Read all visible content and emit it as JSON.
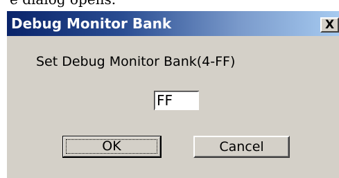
{
  "background": {
    "partial_text": "e dialog opens."
  },
  "dialog": {
    "title": "Debug Monitor Bank",
    "close_icon": "close-icon",
    "close_glyph": "X",
    "prompt": "Set Debug Monitor Bank(4-FF)",
    "input_value": "FF",
    "ok_label": "OK",
    "cancel_label": "Cancel"
  },
  "colors": {
    "title_bar_start": "#0a246a",
    "title_bar_end": "#a6caf0",
    "dialog_face": "#d4d0c8"
  }
}
